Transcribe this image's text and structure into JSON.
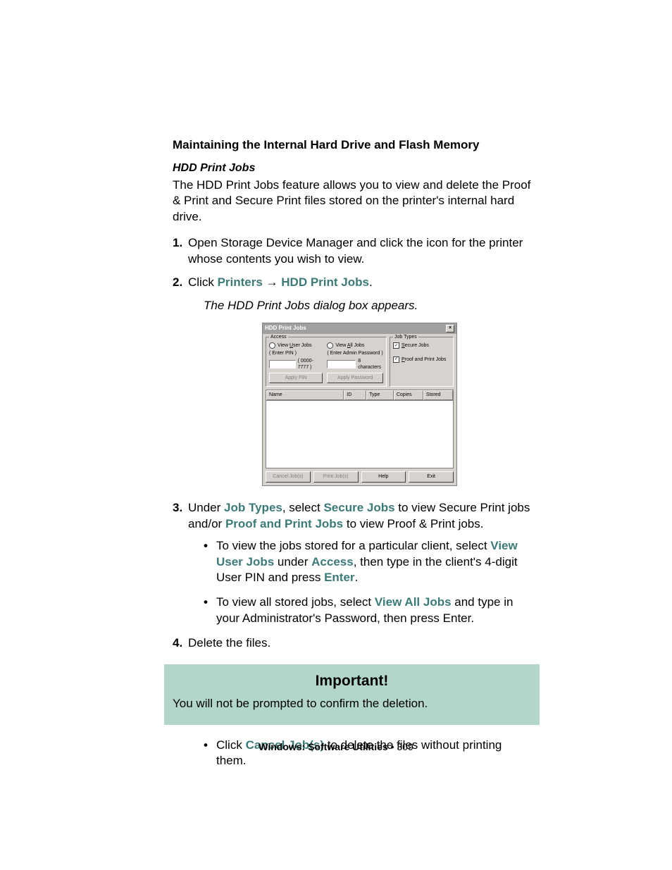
{
  "heading": "Maintaining the Internal Hard Drive and Flash Memory",
  "subheading": "HDD Print Jobs",
  "intro": "The HDD Print Jobs feature allows you to view and delete the Proof & Print and Secure Print files stored on the printer's internal hard drive.",
  "step1": "Open Storage Device Manager and click the icon for the printer whose contents you wish to view.",
  "step2_prefix": "Click ",
  "step2_link1": "Printers",
  "step2_arrow": " → ",
  "step2_link2": "HDD Print Jobs",
  "step2_suffix": ".",
  "step2_note": "The HDD Print Jobs dialog box appears.",
  "dialog": {
    "title": "HDD Print Jobs",
    "close": "×",
    "access_legend": "Access",
    "view_user_jobs": "View User Jobs",
    "enter_pin": "( Enter PIN )",
    "pin_hint": "( 0000-7777 )",
    "apply_pin": "Apply PIN",
    "view_all_jobs": "View All Jobs",
    "enter_admin": "( Enter Admin Password )",
    "char_hint": "8 characters",
    "apply_password": "Apply Password",
    "jobtypes_legend": "Job Types",
    "secure_jobs": "Secure Jobs",
    "proof_print_jobs": "Proof and Print Jobs",
    "col_name": "Name",
    "col_id": "ID",
    "col_type": "Type",
    "col_copies": "Copies",
    "col_stored": "Stored",
    "btn_cancel": "Cancel Job(s)",
    "btn_print": "Print Job(s)",
    "btn_help": "Help",
    "btn_exit": "Exit"
  },
  "step3_a": "Under ",
  "step3_jobtypes": "Job Types",
  "step3_b": ", select ",
  "step3_secure": "Secure Jobs",
  "step3_c": " to view Secure Print jobs and/or ",
  "step3_proof": "Proof and Print Jobs",
  "step3_d": " to view Proof & Print jobs.",
  "step3_bullet1_a": "To view the jobs stored for a particular client, select ",
  "step3_bullet1_view_user": "View User Jobs",
  "step3_bullet1_b": " under ",
  "step3_bullet1_access": "Access",
  "step3_bullet1_c": ", then type in the client's 4-digit User PIN and press ",
  "step3_bullet1_enter": "Enter",
  "step3_bullet1_d": ".",
  "step3_bullet2_a": "To view all stored jobs, select ",
  "step3_bullet2_view_all": "View All Jobs",
  "step3_bullet2_b": " and type in your Administrator's Password, then press Enter.",
  "step4": "Delete the files.",
  "callout_title": "Important!",
  "callout_body": "You will not be prompted to confirm the deletion.",
  "final_bullet_a": "Click ",
  "final_bullet_cancel": "Cancel Job(s)",
  "final_bullet_b": " to delete the files without printing them.",
  "footer_section": "Windows: Software Utilities",
  "footer_sep": "   •   ",
  "footer_page": "309"
}
